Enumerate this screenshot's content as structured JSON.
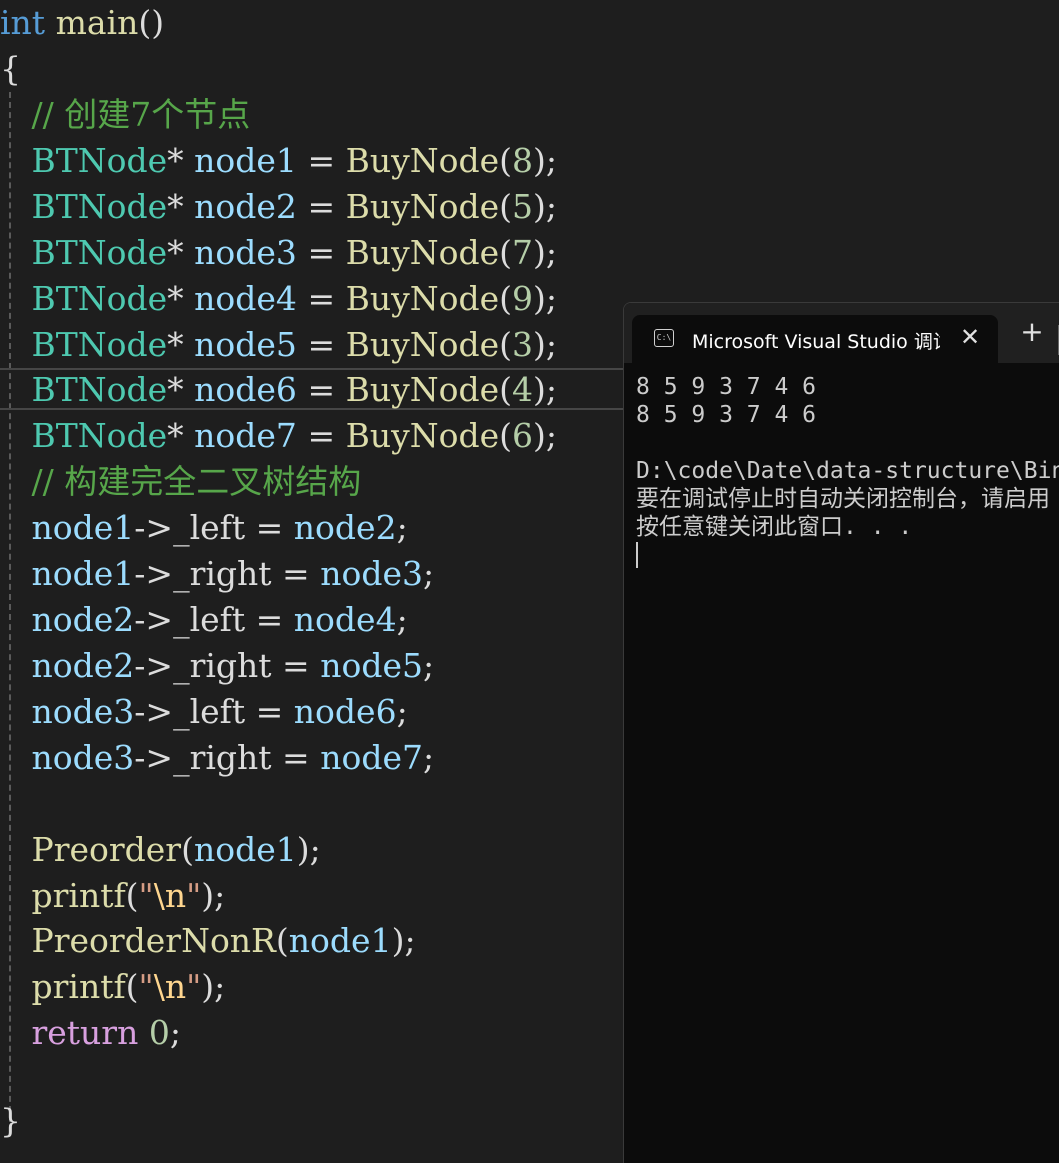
{
  "editor": {
    "lines": {
      "l1": {
        "kw": "int",
        "fn": "main",
        "punc": "()"
      },
      "l2": {
        "brace": "{"
      },
      "l3": {
        "comment": "// 创建7个节点"
      },
      "l4": {
        "type": "BTNode",
        "star": "*",
        "var": "node1",
        "eq": "=",
        "fn": "BuyNode",
        "open": "(",
        "num": "8",
        "close": ");"
      },
      "l5": {
        "type": "BTNode",
        "star": "*",
        "var": "node2",
        "eq": "=",
        "fn": "BuyNode",
        "open": "(",
        "num": "5",
        "close": ");"
      },
      "l6": {
        "type": "BTNode",
        "star": "*",
        "var": "node3",
        "eq": "=",
        "fn": "BuyNode",
        "open": "(",
        "num": "7",
        "close": ");"
      },
      "l7": {
        "type": "BTNode",
        "star": "*",
        "var": "node4",
        "eq": "=",
        "fn": "BuyNode",
        "open": "(",
        "num": "9",
        "close": ");"
      },
      "l8": {
        "type": "BTNode",
        "star": "*",
        "var": "node5",
        "eq": "=",
        "fn": "BuyNode",
        "open": "(",
        "num": "3",
        "close": ");"
      },
      "l9": {
        "type": "BTNode",
        "star": "*",
        "var": "node6",
        "eq": "=",
        "fn": "BuyNode",
        "open": "(",
        "num": "4",
        "close": ");"
      },
      "l10": {
        "type": "BTNode",
        "star": "*",
        "var": "node7",
        "eq": "=",
        "fn": "BuyNode",
        "open": "(",
        "num": "6",
        "close": ");"
      },
      "l11": {
        "comment": "// 构建完全二叉树结构"
      },
      "l12": {
        "var1": "node1",
        "arrow": "->",
        "field": "_left",
        "eq": "=",
        "var2": "node2",
        "semi": ";"
      },
      "l13": {
        "var1": "node1",
        "arrow": "->",
        "field": "_right",
        "eq": "=",
        "var2": "node3",
        "semi": ";"
      },
      "l14": {
        "var1": "node2",
        "arrow": "->",
        "field": "_left",
        "eq": "=",
        "var2": "node4",
        "semi": ";"
      },
      "l15": {
        "var1": "node2",
        "arrow": "->",
        "field": "_right",
        "eq": "=",
        "var2": "node5",
        "semi": ";"
      },
      "l16": {
        "var1": "node3",
        "arrow": "->",
        "field": "_left",
        "eq": "=",
        "var2": "node6",
        "semi": ";"
      },
      "l17": {
        "var1": "node3",
        "arrow": "->",
        "field": "_right",
        "eq": "=",
        "var2": "node7",
        "semi": ";"
      },
      "l19": {
        "fn": "Preorder",
        "open": "(",
        "arg": "node1",
        "close": ");"
      },
      "l20": {
        "fn": "printf",
        "open": "(",
        "q1": "\"",
        "esc": "\\n",
        "q2": "\"",
        "close": ");"
      },
      "l21": {
        "fn": "PreorderNonR",
        "open": "(",
        "arg": "node1",
        "close": ");"
      },
      "l22": {
        "fn": "printf",
        "open": "(",
        "q1": "\"",
        "esc": "\\n",
        "q2": "\"",
        "close": ");"
      },
      "l23": {
        "kw": "return",
        "num": "0",
        "semi": ";"
      },
      "l25": {
        "brace": "}"
      }
    }
  },
  "console": {
    "tab_title": "Microsoft Visual Studio 调试控制台",
    "icon_text": "C:\\",
    "close_glyph": "✕",
    "new_tab_glyph": "+",
    "output": [
      "8 5 9 3 7 4 6",
      "8 5 9 3 7 4 6",
      "",
      "D:\\code\\Date\\data-structure\\BinaryTree",
      "要在调试停止时自动关闭控制台，请启用",
      "按任意键关闭此窗口. . ."
    ]
  }
}
